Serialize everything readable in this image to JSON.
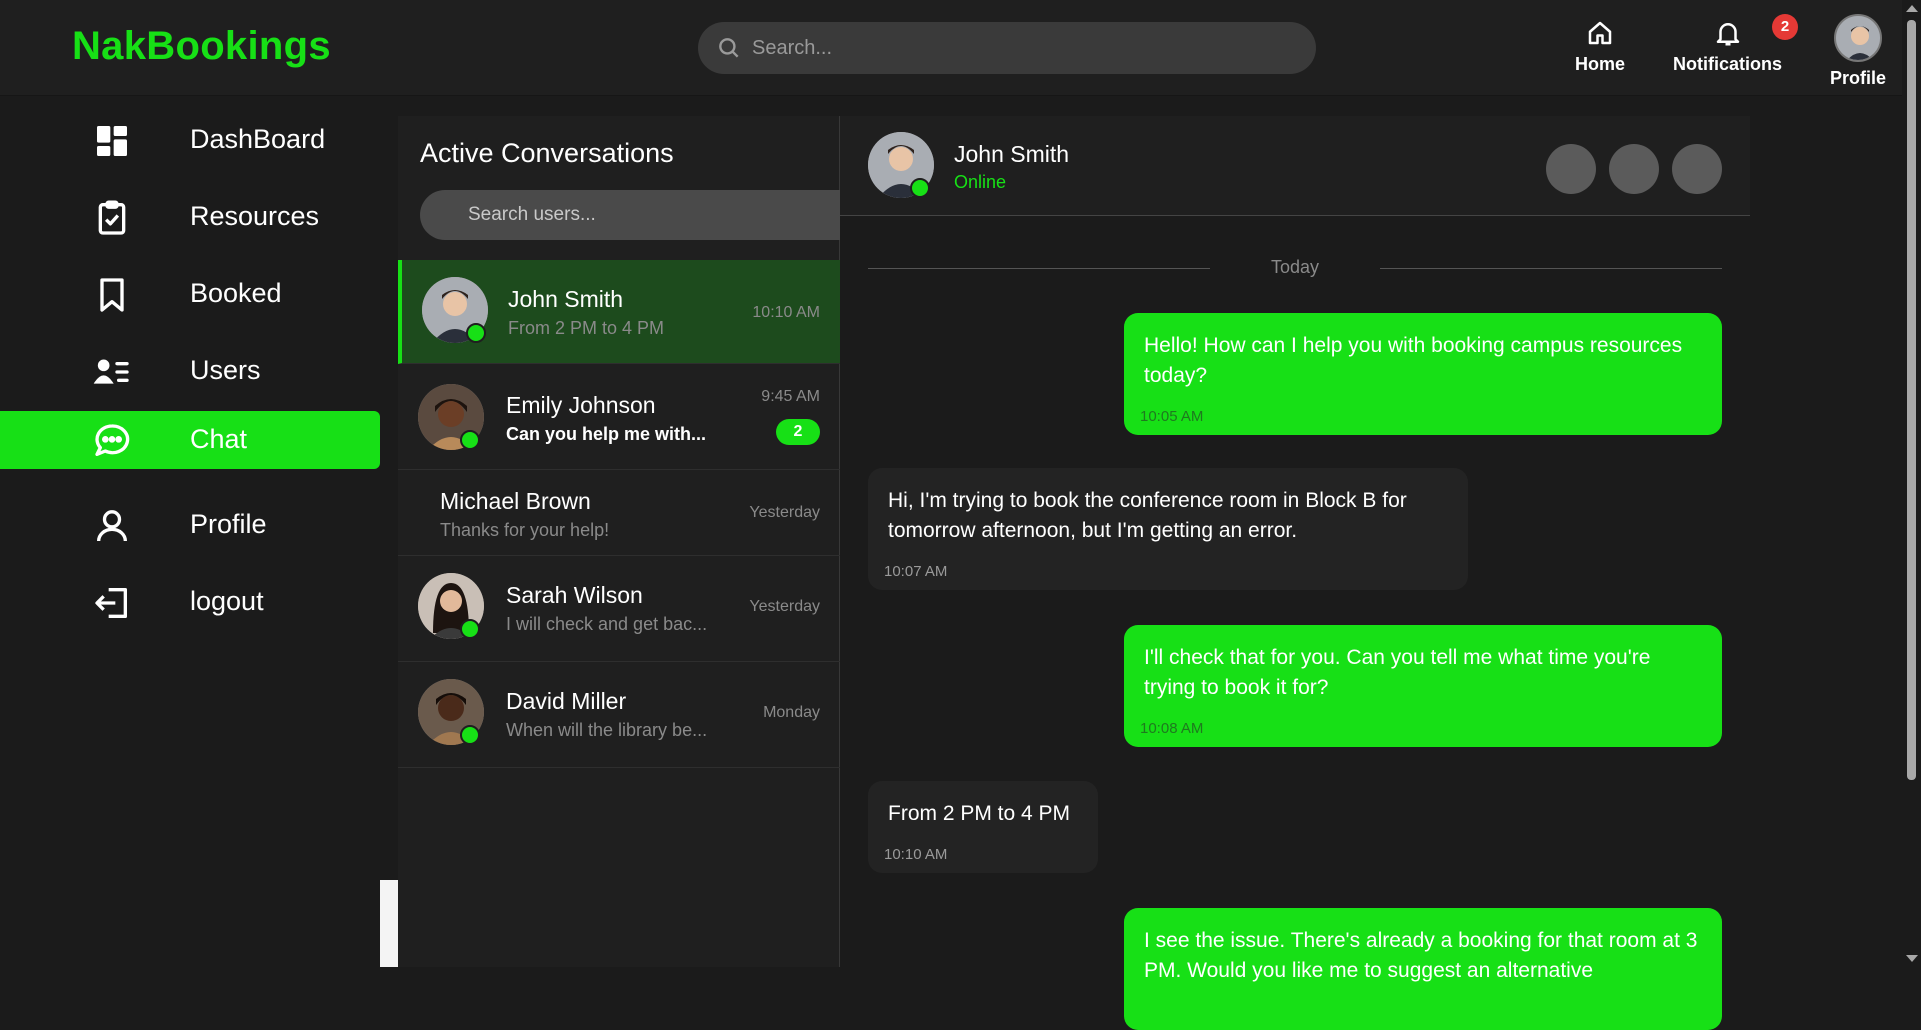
{
  "header": {
    "brand": "NakBookings",
    "search_placeholder": "Search...",
    "nav": {
      "home": "Home",
      "notifications": "Notifications",
      "notifications_count": "2",
      "profile": "Profile"
    }
  },
  "sidebar": {
    "items": [
      {
        "label": "DashBoard",
        "icon": "dashboard-icon"
      },
      {
        "label": "Resources",
        "icon": "clipboard-check-icon"
      },
      {
        "label": "Booked",
        "icon": "bookmark-icon"
      },
      {
        "label": "Users",
        "icon": "users-list-icon"
      },
      {
        "label": "Chat",
        "icon": "chat-bubble-icon",
        "active": true
      },
      {
        "label": "Profile",
        "icon": "person-icon"
      },
      {
        "label": "logout",
        "icon": "logout-icon"
      }
    ]
  },
  "conversations": {
    "title": "Active Conversations",
    "search_placeholder": "Search users...",
    "items": [
      {
        "name": "John Smith",
        "preview": "From 2 PM to 4 PM",
        "time": "10:10 AM",
        "online": true,
        "active": true
      },
      {
        "name": "Emily Johnson",
        "preview": "Can you help me with...",
        "time": "9:45 AM",
        "online": true,
        "unread": "2"
      },
      {
        "name": "Michael Brown",
        "preview": "Thanks for your help!",
        "time": "Yesterday",
        "online": false
      },
      {
        "name": "Sarah Wilson",
        "preview": "I will check and get bac...",
        "time": "Yesterday",
        "online": true
      },
      {
        "name": "David Miller",
        "preview": "When will the library be...",
        "time": "Monday",
        "online": true
      }
    ]
  },
  "chat": {
    "contact_name": "John Smith",
    "contact_status": "Online",
    "divider": "Today",
    "messages": [
      {
        "direction": "out",
        "text": "Hello! How can I help you with booking campus resources today?",
        "time": "10:05 AM"
      },
      {
        "direction": "in",
        "text": "Hi, I'm trying to book the conference room in Block B for tomorrow afternoon, but I'm getting an error.",
        "time": "10:07 AM"
      },
      {
        "direction": "out",
        "text": "I'll check that for you. Can you tell me what time you're trying to book it for?",
        "time": "10:08 AM"
      },
      {
        "direction": "in",
        "text": "From 2 PM to 4 PM",
        "time": "10:10 AM"
      },
      {
        "direction": "out",
        "text": "I see the issue. There's already a booking for that room at 3 PM. Would you like me to suggest an alternative",
        "time": ""
      }
    ]
  },
  "colors": {
    "accent": "#17e016",
    "active_row": "#1d4b1d",
    "badge_red": "#e53935"
  }
}
